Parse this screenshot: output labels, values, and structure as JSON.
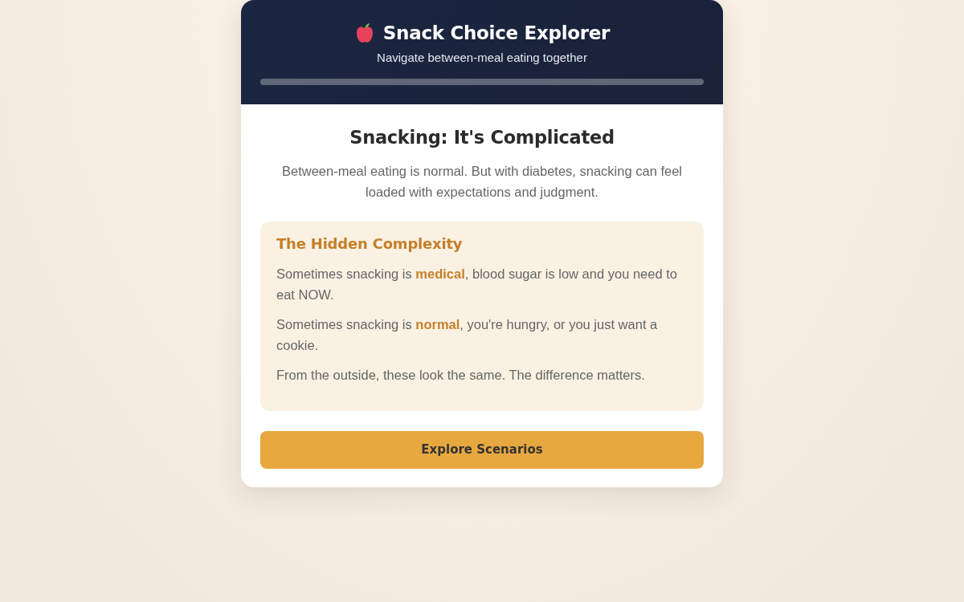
{
  "header": {
    "title": "Snack Choice Explorer",
    "subtitle": "Navigate between-meal eating together",
    "progress": {
      "level": 0
    }
  },
  "intro": {
    "title": "Snacking: It's Complicated",
    "text": "Between-meal eating is normal. But with diabetes, snacking can feel loaded with expectations and judgment."
  },
  "callout": {
    "title": "The Hidden Complexity",
    "paragraphs": [
      "Sometimes snacking is **medical**, blood sugar is low and you need to eat NOW.",
      "Sometimes snacking is **normal**, you're hungry, or you just want a cookie.",
      "From the outside, these look the same. The difference matters."
    ]
  },
  "button": {
    "label": "Explore Scenarios"
  }
}
